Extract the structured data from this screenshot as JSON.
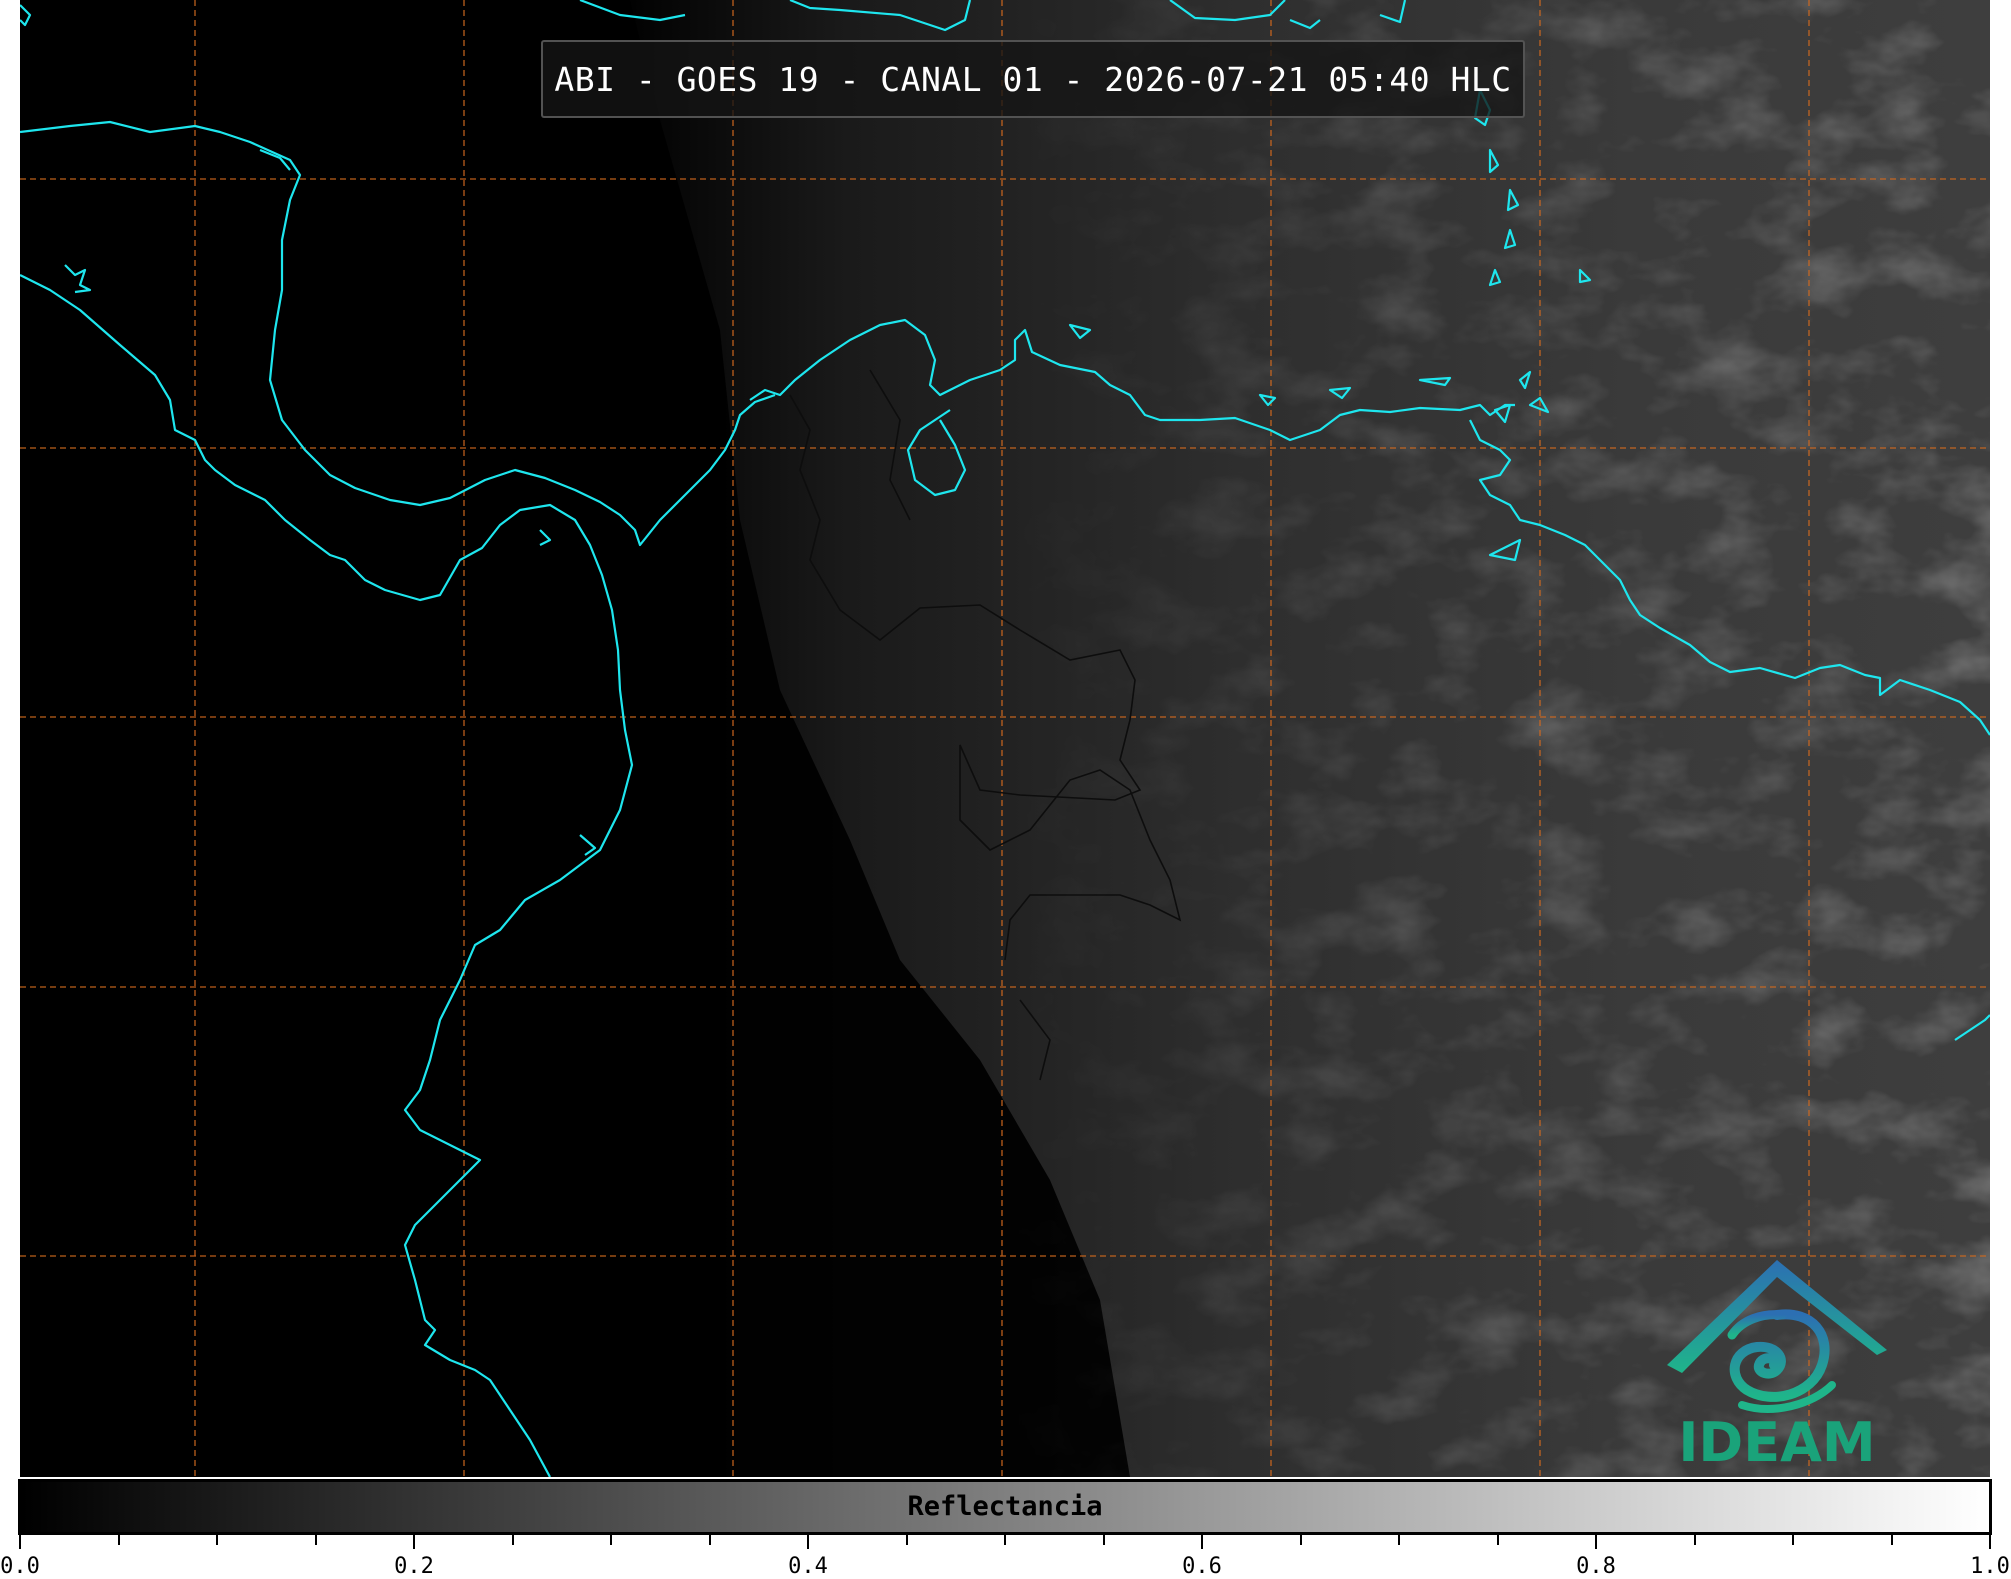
{
  "title": "ABI - GOES 19 - CANAL 01 - 2026-07-21 05:40 HLC",
  "logo": {
    "text": "IDEAM",
    "icon": "ideam-mountain-swirl-logo"
  },
  "colorbar": {
    "label": "Reflectancia",
    "min": 0.0,
    "max": 1.0,
    "tick_labels": [
      "0.0",
      "0.2",
      "0.4",
      "0.6",
      "0.8",
      "1.0"
    ],
    "colors": {
      "low": "#000000",
      "high": "#ffffff"
    }
  },
  "map": {
    "coastline_color": "#1ee6ee",
    "gridline_color": "#d2691e",
    "border_color": "#111111"
  }
}
